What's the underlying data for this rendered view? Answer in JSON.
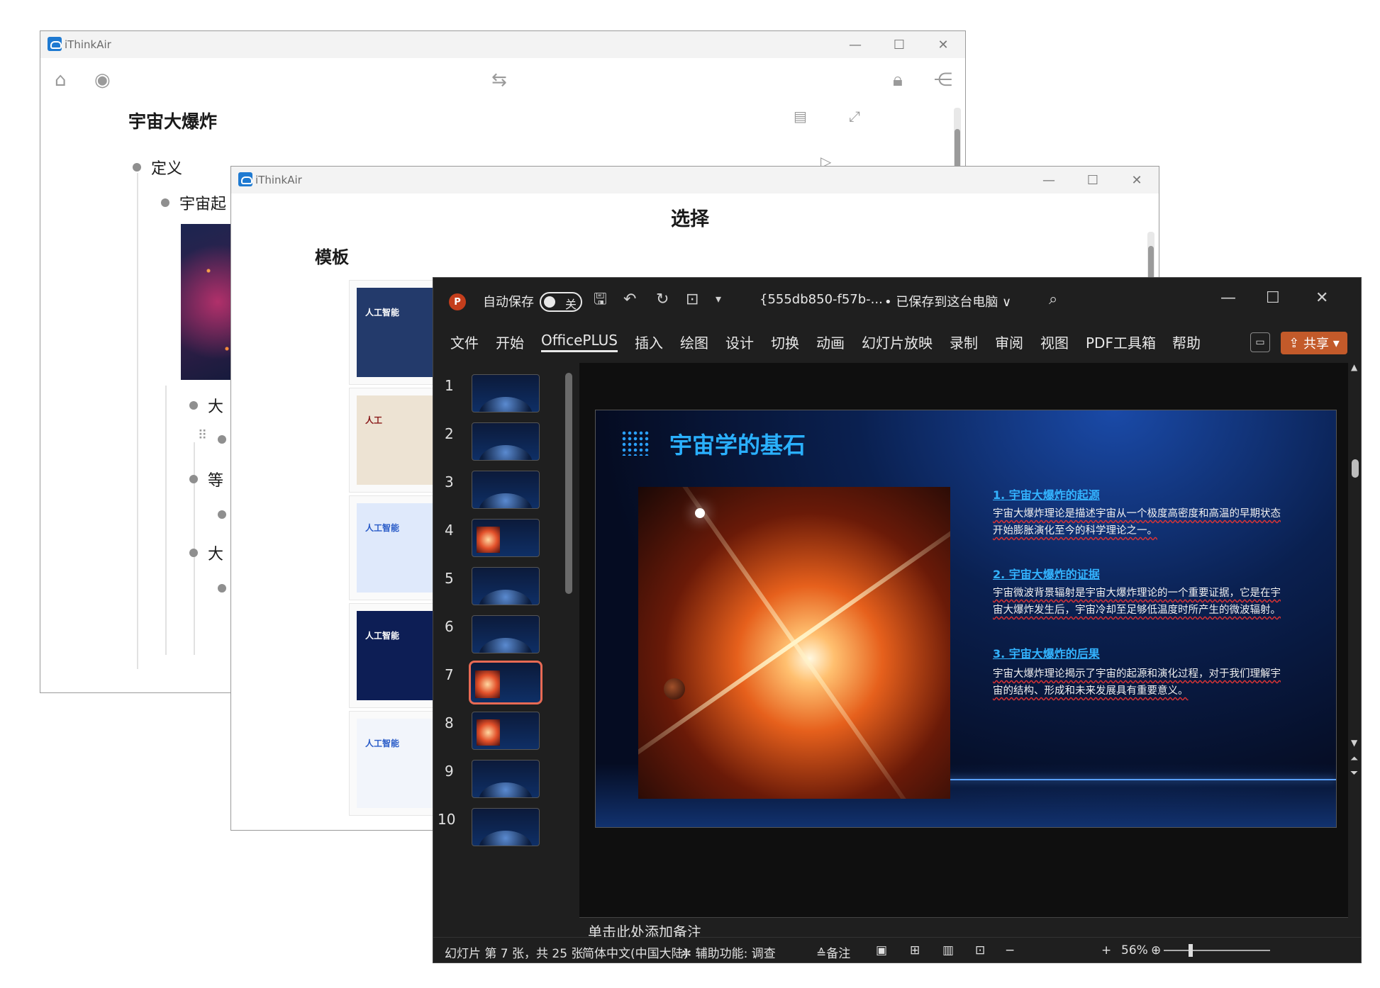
{
  "window1": {
    "app_name": "iThinkAir",
    "doc_title": "宇宙大爆炸",
    "nodes": [
      {
        "text": "定义"
      },
      {
        "text": "宇宙起"
      },
      {
        "text": "大"
      },
      {
        "text": "等"
      },
      {
        "text": "大"
      }
    ]
  },
  "window2": {
    "app_name": "iThinkAir",
    "title": "选择",
    "section_label": "模板",
    "templates": [
      {
        "label": "人工智能",
        "bg": "#233a6b",
        "color": "#ffffff"
      },
      {
        "label": "人工",
        "bg": "#ede3d3",
        "color": "#8a1a1a"
      },
      {
        "label": "人工智能",
        "bg": "#dfe9fb",
        "color": "#2a5cc8"
      },
      {
        "label": "人工智能",
        "bg": "#0d1e55",
        "color": "#ffffff"
      },
      {
        "label": "人工智能",
        "bg": "#f2f5fb",
        "color": "#2a5cc8"
      }
    ]
  },
  "ppt": {
    "autosave_label": "自动保存",
    "toggle_state": "关",
    "filename": "{555db850-f57b-...",
    "save_status": "• 已保存到这台电脑 ∨",
    "ribbon_tabs": [
      "文件",
      "开始",
      "OfficePLUS",
      "插入",
      "绘图",
      "设计",
      "切换",
      "动画",
      "幻灯片放映",
      "录制",
      "审阅",
      "视图",
      "PDF工具箱",
      "帮助"
    ],
    "active_tab": "OfficePLUS",
    "share_label": "共享",
    "thumbnails": [
      "1",
      "2",
      "3",
      "4",
      "5",
      "6",
      "7",
      "8",
      "9",
      "10"
    ],
    "selected_slide": 7,
    "slide": {
      "heading": "宇宙学的基石",
      "sections": [
        {
          "title": "1. 宇宙大爆炸的起源",
          "body": "宇宙大爆炸理论是描述宇宙从一个极度高密度和高温的早期状态开始膨胀演化至今的科学理论之一。"
        },
        {
          "title": "2. 宇宙大爆炸的证据",
          "body": "宇宙微波背景辐射是宇宙大爆炸理论的一个重要证据，它是在宇宙大爆炸发生后，宇宙冷却至足够低温度时所产生的微波辐射。"
        },
        {
          "title": "3. 宇宙大爆炸的后果",
          "body": "宇宙大爆炸理论揭示了宇宙的起源和演化过程，对于我们理解宇宙的结构、形成和未来发展具有重要意义。"
        }
      ]
    },
    "notes_placeholder": "单击此处添加备注",
    "status": {
      "slide_info": "幻灯片 第 7 张，共 25 张",
      "language": "简体中文(中国大陆)",
      "accessibility": "辅助功能: 调查",
      "notes_btn": "备注",
      "zoom": "56%"
    }
  }
}
